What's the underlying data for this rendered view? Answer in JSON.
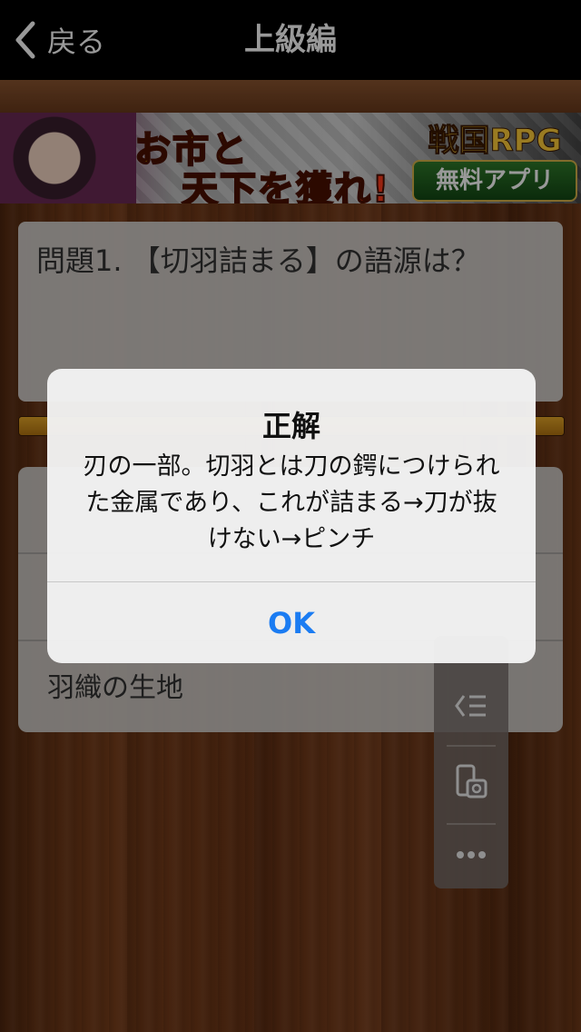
{
  "nav": {
    "back_label": "戻る",
    "title": "上級編"
  },
  "banner": {
    "line1": "お市と",
    "line2": "天下を獲れ!",
    "badge": "戦国RPG",
    "app_label": "無料アプリ"
  },
  "question": {
    "text": "問題1. 【切羽詰まる】の語源は？"
  },
  "progress": {
    "fraction": 1.0
  },
  "answers": {
    "items": [
      "",
      "",
      "羽織の生地"
    ]
  },
  "toolbar": {
    "icons": [
      "list-collapse-icon",
      "screenshot-icon",
      "more-icon"
    ]
  },
  "alert": {
    "title": "正解",
    "message_line1": "刃の一部。切羽とは刀の鍔につけられ",
    "message_line2": "た金属であり、これが詰まる→刀が抜",
    "message_line3": "けない→ピンチ",
    "ok_label": "OK"
  },
  "colors": {
    "navbar": "#000000",
    "accent": "#1b7cf2",
    "wood": "#6a3416"
  }
}
